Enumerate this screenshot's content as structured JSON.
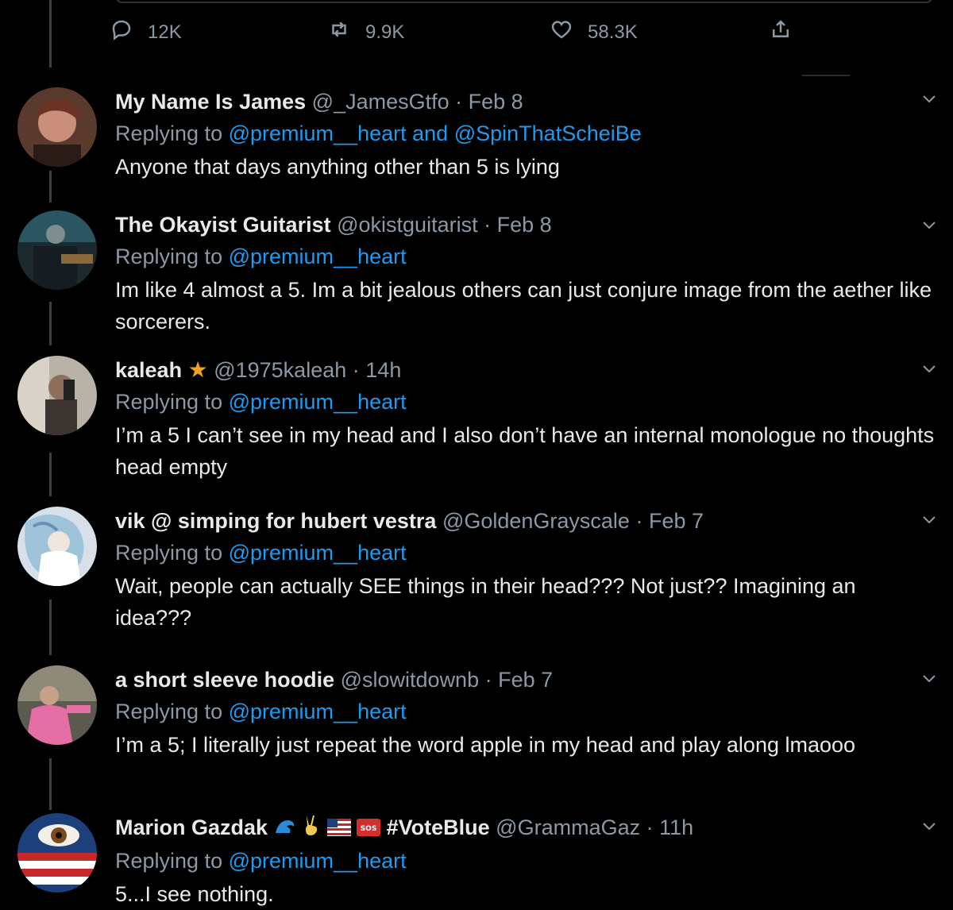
{
  "actions": {
    "reply_count": "12K",
    "retweet_count": "9.9K",
    "like_count": "58.3K"
  },
  "replies": [
    {
      "name": "My Name Is James",
      "handle": "@_JamesGtfo",
      "sep": "·",
      "time": "Feb 8",
      "replying_prefix": "Replying to",
      "mention1": "@premium__heart",
      "conj": "and",
      "mention2": "@SpinThatScheiBe",
      "text": "Anyone that days anything other than 5 is lying"
    },
    {
      "name": "The Okayist Guitarist",
      "handle": "@okistguitarist",
      "sep": "·",
      "time": "Feb 8",
      "replying_prefix": "Replying to",
      "mention1": "@premium__heart",
      "text": "Im like 4 almost a 5. Im a bit jealous others can just conjure image from the aether like sorcerers."
    },
    {
      "name": "kaleah",
      "handle": "@1975kaleah",
      "sep": "·",
      "time": "14h",
      "replying_prefix": "Replying to",
      "mention1": "@premium__heart",
      "text": "I’m a 5 I can’t see in my head and I also don’t have an internal monologue no thoughts head empty"
    },
    {
      "name": "vik @ simping for hubert vestra",
      "handle": "@GoldenGrayscale",
      "sep": "·",
      "time": "Feb 7",
      "replying_prefix": "Replying to",
      "mention1": "@premium__heart",
      "text": "Wait, people can actually SEE things in their head??? Not just?? Imagining an idea???"
    },
    {
      "name": "a short sleeve hoodie",
      "handle": "@slowitdownb",
      "sep": "·",
      "time": "Feb 7",
      "replying_prefix": "Replying to",
      "mention1": "@premium__heart",
      "text": "I’m a 5; I literally just repeat the word apple in my head and play along lmaooo"
    },
    {
      "name": "Marion Gazdak",
      "name_suffix": "#VoteBlue",
      "handle": "@GrammaGaz",
      "sep": "·",
      "time": "11h",
      "replying_prefix": "Replying to",
      "mention1": "@premium__heart",
      "text": "5...I see nothing."
    }
  ],
  "colors": {
    "background": "#000000",
    "text": "#e7e9ea",
    "muted": "#8b98a5",
    "link": "#1d9bf0"
  }
}
